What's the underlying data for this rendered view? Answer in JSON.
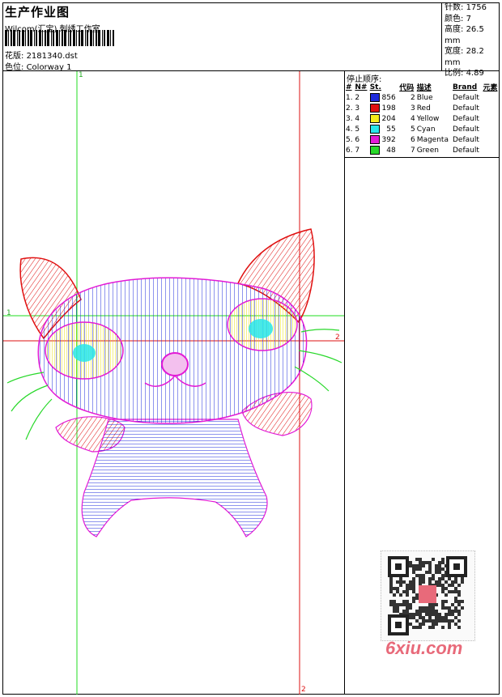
{
  "header": {
    "title": "生产作业图",
    "company": "Wilcom(汇宝) 刺绣工作室",
    "design_file_label": "花版:",
    "design_file": "2181340.dst",
    "colorway_label": "色位:",
    "colorway": "Colorway 1"
  },
  "specs": {
    "stitches_label": "针数:",
    "stitches": "1756",
    "colors_label": "颜色:",
    "colors": "7",
    "height_label": "高度:",
    "height": "26.5 mm",
    "width_label": "宽度:",
    "width": "28.2 mm",
    "scale_label": "比例:",
    "scale": "4.89"
  },
  "stop_sequence": {
    "title": "停止顺序:",
    "columns": [
      "#",
      "N#",
      "St.",
      "代码",
      "描述",
      "Brand",
      "元素"
    ],
    "rows": [
      {
        "idx": "1.",
        "n": "2",
        "color": "#1e2bdc",
        "st": "856",
        "code": "2",
        "desc": "Blue",
        "brand": "Default"
      },
      {
        "idx": "2.",
        "n": "3",
        "color": "#e01010",
        "st": "198",
        "code": "3",
        "desc": "Red",
        "brand": "Default"
      },
      {
        "idx": "3.",
        "n": "4",
        "color": "#f5ec1a",
        "st": "204",
        "code": "4",
        "desc": "Yellow",
        "brand": "Default"
      },
      {
        "idx": "4.",
        "n": "5",
        "color": "#28e6ea",
        "st": "55",
        "code": "5",
        "desc": "Cyan",
        "brand": "Default"
      },
      {
        "idx": "5.",
        "n": "6",
        "color": "#e21ad6",
        "st": "392",
        "code": "6",
        "desc": "Magenta",
        "brand": "Default"
      },
      {
        "idx": "6.",
        "n": "7",
        "color": "#28d82a",
        "st": "48",
        "code": "7",
        "desc": "Green",
        "brand": "Default"
      }
    ]
  },
  "guides": {
    "v_top": "1",
    "h_left": "1",
    "h_right": "2",
    "v_bottom": "2"
  },
  "watermark": "6xiu.com",
  "colors": {
    "guide_green": "#22dd22",
    "guide_red": "#dd1111"
  }
}
